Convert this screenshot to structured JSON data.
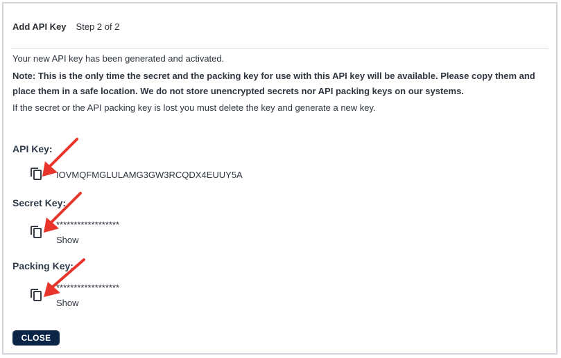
{
  "dialog": {
    "title": "Add API Key",
    "step": "Step 2 of 2"
  },
  "messages": {
    "generated": "Your new API key has been generated and activated.",
    "note": "Note: This is the only time the secret and the packing key for use with this API key will be available. Please copy them and place them in a safe location. We do not store unencrypted secrets nor API packing keys on our systems.",
    "lost": "If the secret or the API packing key is lost you must delete the key and generate a new key."
  },
  "api_key": {
    "label": "API Key:",
    "value": "IOVMQFMGLULAMG3GW3RCQDX4EUUY5A",
    "icon": "copy-icon"
  },
  "secret_key": {
    "label": "Secret Key:",
    "masked_value": "******************",
    "show_label": "Show",
    "icon": "copy-icon"
  },
  "packing_key": {
    "label": "Packing Key:",
    "masked_value": "******************",
    "show_label": "Show",
    "icon": "copy-icon"
  },
  "footer": {
    "close_label": "CLOSE"
  },
  "colors": {
    "button_bg": "#0b2547",
    "arrow": "#e8342a",
    "border": "#cfd4db"
  }
}
